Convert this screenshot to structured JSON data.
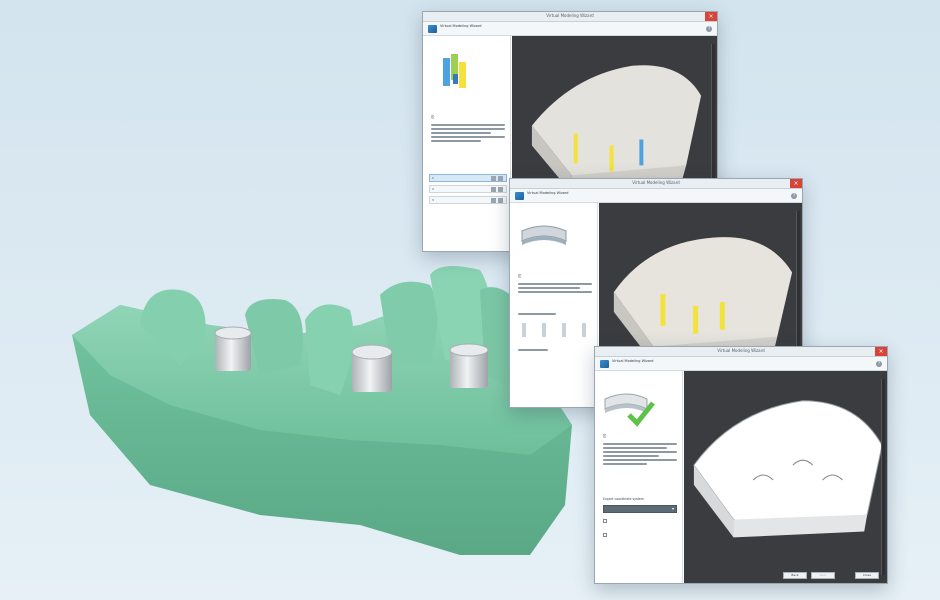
{
  "windows": [
    {
      "title": "Virtual Modeling Wizard",
      "header_title": "Virtual Modeling Wizard",
      "header_subtitle": "",
      "rows": [
        {
          "num": "1",
          "name": ""
        },
        {
          "num": "2",
          "name": ""
        },
        {
          "num": "3",
          "name": ""
        }
      ]
    },
    {
      "title": "Virtual Modeling Wizard",
      "header_title": "Virtual Modeling Wizard",
      "header_subtitle": ""
    },
    {
      "title": "Virtual Modeling Wizard",
      "header_title": "Virtual Modeling Wizard",
      "header_subtitle": "",
      "section": "Export coordinate system",
      "dropdown_value": "",
      "buttons": [
        "Back",
        "Next",
        "Close"
      ]
    }
  ],
  "colors": {
    "model_green": "#79c9a7",
    "analog_silver": "#c9cdd0",
    "viewport_bg": "#3b3c40",
    "analog_yellow": "#f3e23b",
    "analog_blue": "#4da3e0",
    "check_green": "#5ec24a"
  },
  "icons": {
    "close": "close-icon",
    "help": "help-icon",
    "app": "app-icon",
    "dropdown": "chevron-down-icon"
  }
}
